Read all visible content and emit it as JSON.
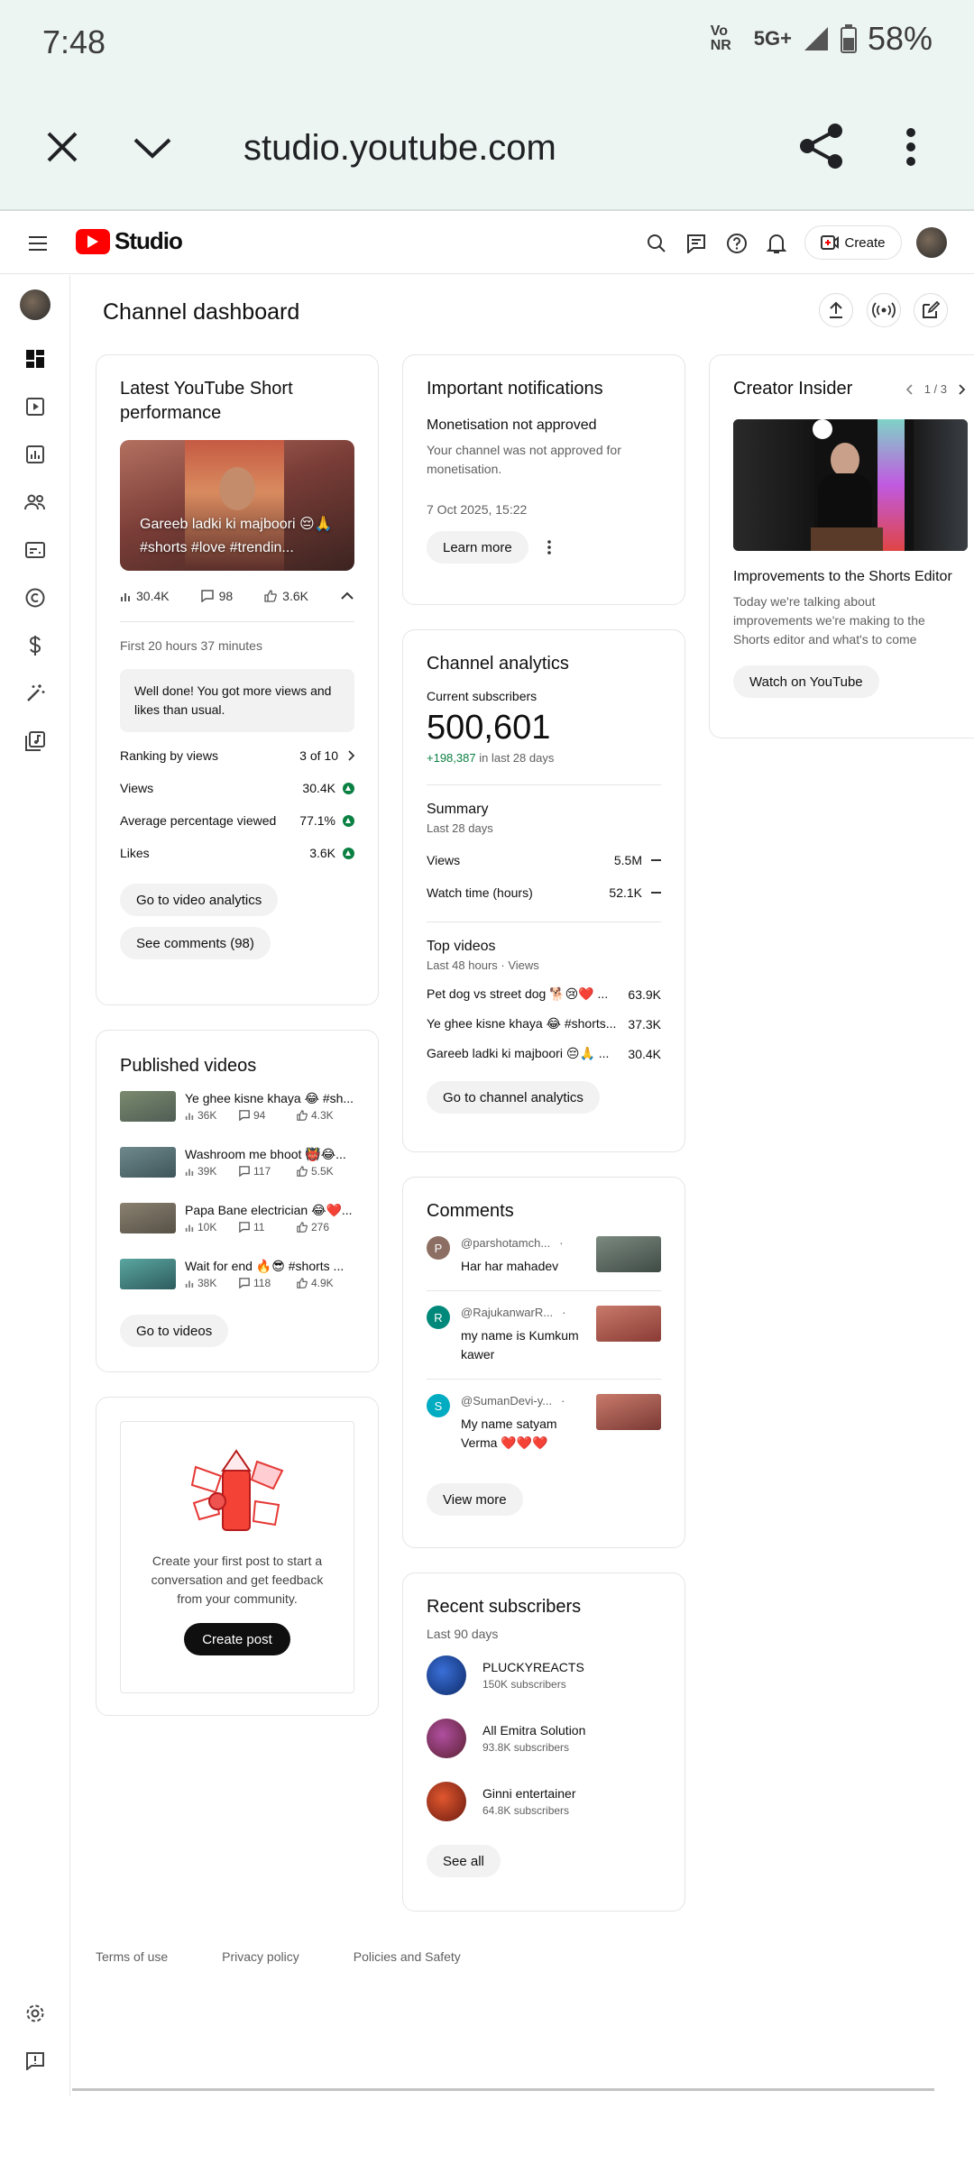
{
  "status_bar": {
    "time": "7:48",
    "network": "Vo NR",
    "signal": "5G+",
    "battery": "58%"
  },
  "browser": {
    "url": "studio.youtube.com"
  },
  "topbar": {
    "brand": "Studio",
    "create_label": "Create"
  },
  "page": {
    "title": "Channel dashboard"
  },
  "short_card": {
    "title": "Latest YouTube Short performance",
    "video_title": "Gareeb ladki ki majboori 😔🙏 #shorts #love #trendin...",
    "views": "30.4K",
    "comments": "98",
    "likes": "3.6K",
    "period": "First 20 hours 37 minutes",
    "message": "Well done! You got more views and likes than usual.",
    "ranking_label": "Ranking by views",
    "ranking_value": "3 of 10",
    "metrics": [
      {
        "label": "Views",
        "value": "30.4K"
      },
      {
        "label": "Average percentage viewed",
        "value": "77.1%"
      },
      {
        "label": "Likes",
        "value": "3.6K"
      }
    ],
    "analytics_btn": "Go to video analytics",
    "comments_btn": "See comments (98)"
  },
  "published": {
    "title": "Published videos",
    "videos": [
      {
        "title": "Ye ghee kisne khaya 😂 #sh...",
        "views": "36K",
        "comments": "94",
        "likes": "4.3K"
      },
      {
        "title": "Washroom me bhoot 👹😂...",
        "views": "39K",
        "comments": "117",
        "likes": "5.5K"
      },
      {
        "title": "Papa Bane electrician 😂❤️...",
        "views": "10K",
        "comments": "11",
        "likes": "276"
      },
      {
        "title": "Wait for end 🔥😎 #shorts ...",
        "views": "38K",
        "comments": "118",
        "likes": "4.9K"
      }
    ],
    "button": "Go to videos"
  },
  "post": {
    "text": "Create your first post to start a conversation and get feedback from your community.",
    "button": "Create post"
  },
  "notifications": {
    "title": "Important notifications",
    "heading": "Monetisation not approved",
    "body": "Your channel was not approved for monetisation.",
    "date": "7 Oct 2025, 15:22",
    "button": "Learn more"
  },
  "analytics": {
    "title": "Channel analytics",
    "subs_label": "Current subscribers",
    "subs_value": "500,601",
    "subs_delta": "+198,387",
    "subs_delta_suffix": "in last 28 days",
    "summary_title": "Summary",
    "summary_period": "Last 28 days",
    "summary": [
      {
        "label": "Views",
        "value": "5.5M"
      },
      {
        "label": "Watch time (hours)",
        "value": "52.1K"
      }
    ],
    "top_title": "Top videos",
    "top_period": "Last 48 hours · Views",
    "top": [
      {
        "title": "Pet dog vs street dog 🐕😢❤️ ...",
        "value": "63.9K"
      },
      {
        "title": "Ye ghee kisne khaya 😂 #shorts...",
        "value": "37.3K"
      },
      {
        "title": "Gareeb ladki ki majboori 😔🙏 ...",
        "value": "30.4K"
      }
    ],
    "button": "Go to channel analytics"
  },
  "comments": {
    "title": "Comments",
    "items": [
      {
        "initial": "P",
        "color": "#8d6e63",
        "author": "@parshotamch...",
        "text": "Har har mahadev"
      },
      {
        "initial": "R",
        "color": "#00897b",
        "author": "@RajukanwarR...",
        "text": "my name is Kumkum kawer"
      },
      {
        "initial": "S",
        "color": "#00acc1",
        "author": "@SumanDevi-y...",
        "text": "My name satyam Verma ❤️❤️❤️"
      }
    ],
    "button": "View more"
  },
  "subscribers": {
    "title": "Recent subscribers",
    "period": "Last 90 days",
    "items": [
      {
        "name": "PLUCKYREACTS",
        "count": "150K subscribers"
      },
      {
        "name": "All Emitra Solution",
        "count": "93.8K subscribers"
      },
      {
        "name": "Ginni entertainer",
        "count": "64.8K subscribers"
      }
    ],
    "button": "See all"
  },
  "insider": {
    "title": "Creator Insider",
    "pager": "1 / 3",
    "video_title": "Improvements to the Shorts Editor",
    "desc": "Today we're talking about improvements we're making to the Shorts editor and what's to come",
    "button": "Watch on YouTube"
  },
  "footer": {
    "terms": "Terms of use",
    "privacy": "Privacy policy",
    "policies": "Policies and Safety"
  }
}
